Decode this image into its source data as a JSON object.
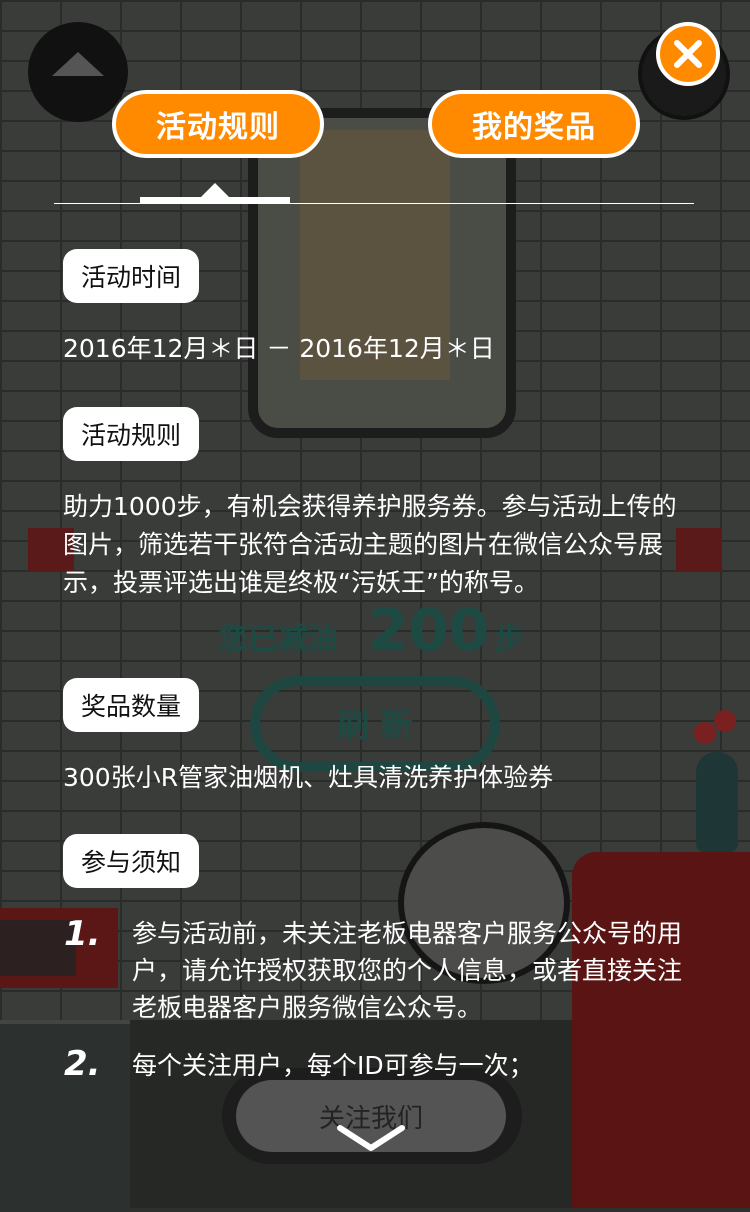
{
  "background": {
    "ghost_steps_label": "您已减油",
    "ghost_steps_value": "200",
    "ghost_steps_unit": "步",
    "ghost_refresh_label": "刷 新",
    "ghost_follow_label": "关注我们"
  },
  "tabs": [
    {
      "label": "活动规则",
      "active": true
    },
    {
      "label": "我的奖品",
      "active": false
    }
  ],
  "sections": {
    "time": {
      "title": "活动时间",
      "body": "2016年12月＊日 － 2016年12月＊日"
    },
    "rules": {
      "title": "活动规则",
      "body": "助力1000步，有机会获得养护服务券。参与活动上传的图片，筛选若干张符合活动主题的图片在微信公众号展示，投票评选出谁是终极“污妖王”的称号。"
    },
    "prizes": {
      "title": "奖品数量",
      "body": "300张小R管家油烟机、灶具清洗养护体验券"
    },
    "notes": {
      "title": "参与须知",
      "items": [
        {
          "num": "1.",
          "text": "参与活动前，未关注老板电器客户服务公众号的用户，请允许授权获取您的个人信息，或者直接关注老板电器客户服务微信公众号。"
        },
        {
          "num": "2.",
          "text": "每个关注用户，每个ID可参与一次；"
        }
      ]
    }
  },
  "colors": {
    "accent": "#ff8a00",
    "overlay_text": "#ffffff",
    "pill_bg": "#ffffff"
  },
  "icons": {
    "close": "close-icon",
    "scroll_down": "chevron-down-icon"
  }
}
